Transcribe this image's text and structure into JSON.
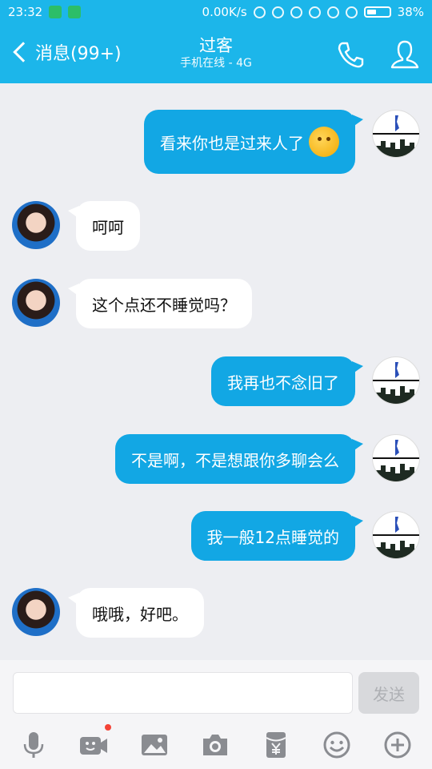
{
  "status": {
    "time": "23:32",
    "network_speed": "0.00K/s",
    "battery_percent": "38%"
  },
  "nav": {
    "back_label": "消息(99+)",
    "title": "过客",
    "subtitle": "手机在线 - 4G"
  },
  "messages": [
    {
      "side": "out",
      "text": "看来你也是过来人了",
      "emoji": "hand-over-mouth-emoji"
    },
    {
      "side": "in",
      "text": "呵呵"
    },
    {
      "side": "in",
      "text": "这个点还不睡觉吗？"
    },
    {
      "side": "out",
      "text": "我再也不念旧了"
    },
    {
      "side": "out",
      "text": "不是啊，不是想跟你多聊会么"
    },
    {
      "side": "out",
      "text": "我一般12点睡觉的"
    },
    {
      "side": "in",
      "text": "哦哦，好吧。"
    }
  ],
  "input": {
    "value": "",
    "placeholder": "",
    "send_label": "发送"
  },
  "toolbar_icons": [
    "microphone-icon",
    "video-icon",
    "image-icon",
    "camera-icon",
    "red-packet-icon",
    "emoji-icon",
    "plus-icon"
  ],
  "colors": {
    "header": "#1cb6ea",
    "outgoing_bubble": "#12a7e4",
    "incoming_bubble": "#ffffff",
    "background": "#edeef2"
  }
}
